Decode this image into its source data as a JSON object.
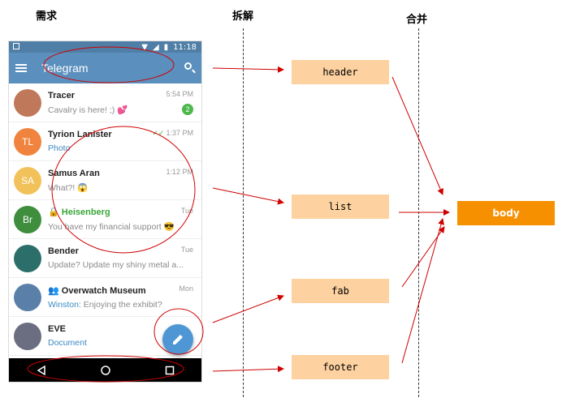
{
  "columns": {
    "need": "需求",
    "split": "拆解",
    "merge": "合并"
  },
  "phone": {
    "status_time": "11:18",
    "app_title": "Telegram",
    "chats": [
      {
        "name": "Tracer",
        "message": "Cavalry is here! ;) 💕",
        "time": "5:54 PM",
        "badge": "2",
        "avatar_color": "#c0785a",
        "avatar_text": ""
      },
      {
        "name": "Tyrion Lanister",
        "message": "Photo",
        "time": "1:37 PM",
        "avatar_color": "#f0833e",
        "avatar_text": "TL"
      },
      {
        "name": "Samus Aran",
        "message": "What?! 😱",
        "time": "1:12 PM",
        "avatar_color": "#f2c25a",
        "avatar_text": "SA"
      },
      {
        "name": "Heisenberg",
        "message": "You have my financial support 😎",
        "time": "Tue",
        "avatar_color": "#3e8e3e",
        "avatar_text": "Br"
      },
      {
        "name": "Bender",
        "message": "Update? Update my shiny metal a...",
        "time": "Tue",
        "avatar_color": "#2c6f6a",
        "avatar_text": ""
      },
      {
        "name": "Overwatch Museum",
        "message_prefix": "Winston:",
        "message": "Enjoying the exhibit?",
        "time": "Mon",
        "avatar_color": "#5a7fa8",
        "avatar_text": ""
      },
      {
        "name": "EVE",
        "message": "Document",
        "time": "",
        "avatar_color": "#6b6d80",
        "avatar_text": ""
      }
    ]
  },
  "boxes": {
    "header": "header",
    "list": "list",
    "fab": "fab",
    "footer": "footer",
    "body": "body"
  },
  "colors": {
    "box_fill": "#fdd2a0",
    "body_fill": "#f79000",
    "arrow": "#d00000",
    "appbar": "#5b8fbd"
  }
}
